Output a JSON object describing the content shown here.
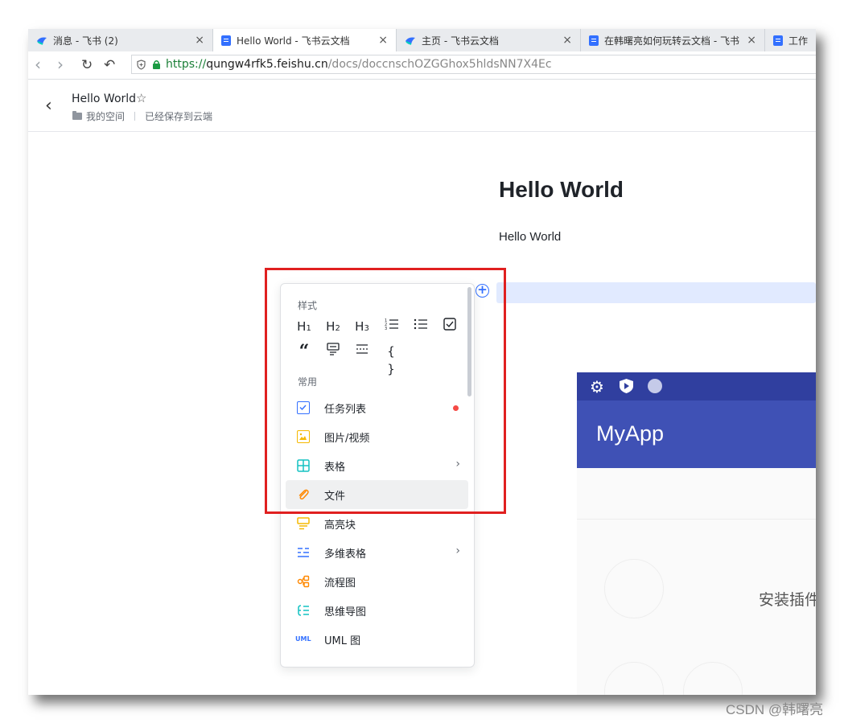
{
  "tabs": [
    {
      "label": "消息 - 飞书 (2)",
      "close": "×",
      "icon": "feishu-bird-icon"
    },
    {
      "label": "Hello World - 飞书云文档",
      "close": "×",
      "icon": "doc-icon"
    },
    {
      "label": "主页 - 飞书云文档",
      "close": "×",
      "icon": "feishu-bird-icon"
    },
    {
      "label": "在韩曙亮如何玩转云文档 - 飞书",
      "close": "×",
      "icon": "doc-icon"
    },
    {
      "label": "工作",
      "close": "",
      "icon": "doc-icon"
    }
  ],
  "address": {
    "scheme": "https://",
    "host": "qungw4rfk5.feishu.cn",
    "path": "/docs/doccnschOZGGhox5hldsNN7X4Ec"
  },
  "header": {
    "title": "Hello World",
    "space": "我的空间",
    "status": "已经保存到云端"
  },
  "content": {
    "heading": "Hello World",
    "paragraph": "Hello World"
  },
  "menu": {
    "style_heading": "样式",
    "style_buttons": [
      "H1",
      "H2",
      "H3",
      "1☰",
      "☰",
      "☑",
      "❝",
      "▤",
      "⋯",
      "{ }"
    ],
    "common_heading": "常用",
    "items": [
      {
        "label": "任务列表",
        "icon": "checkbox-icon",
        "color": "#3370ff",
        "new": true
      },
      {
        "label": "图片/视频",
        "icon": "image-icon",
        "color": "#f5b800"
      },
      {
        "label": "表格",
        "icon": "table-icon",
        "color": "#13c2c2",
        "submenu": true
      },
      {
        "label": "文件",
        "icon": "paperclip-icon",
        "color": "#ff8800",
        "hover": true
      },
      {
        "label": "高亮块",
        "icon": "highlight-icon",
        "color": "#f5b800"
      },
      {
        "label": "多维表格",
        "icon": "bitable-icon",
        "color": "#3370ff",
        "submenu": true
      },
      {
        "label": "流程图",
        "icon": "flowchart-icon",
        "color": "#ff8800"
      },
      {
        "label": "思维导图",
        "icon": "mindmap-icon",
        "color": "#13c2c2"
      },
      {
        "label": "UML 图",
        "icon": "uml-icon",
        "color": "#3370ff",
        "icon_text": "UML"
      }
    ]
  },
  "app": {
    "title": "MyApp",
    "install_text": "安装插件"
  },
  "watermark": "CSDN @韩曙亮"
}
